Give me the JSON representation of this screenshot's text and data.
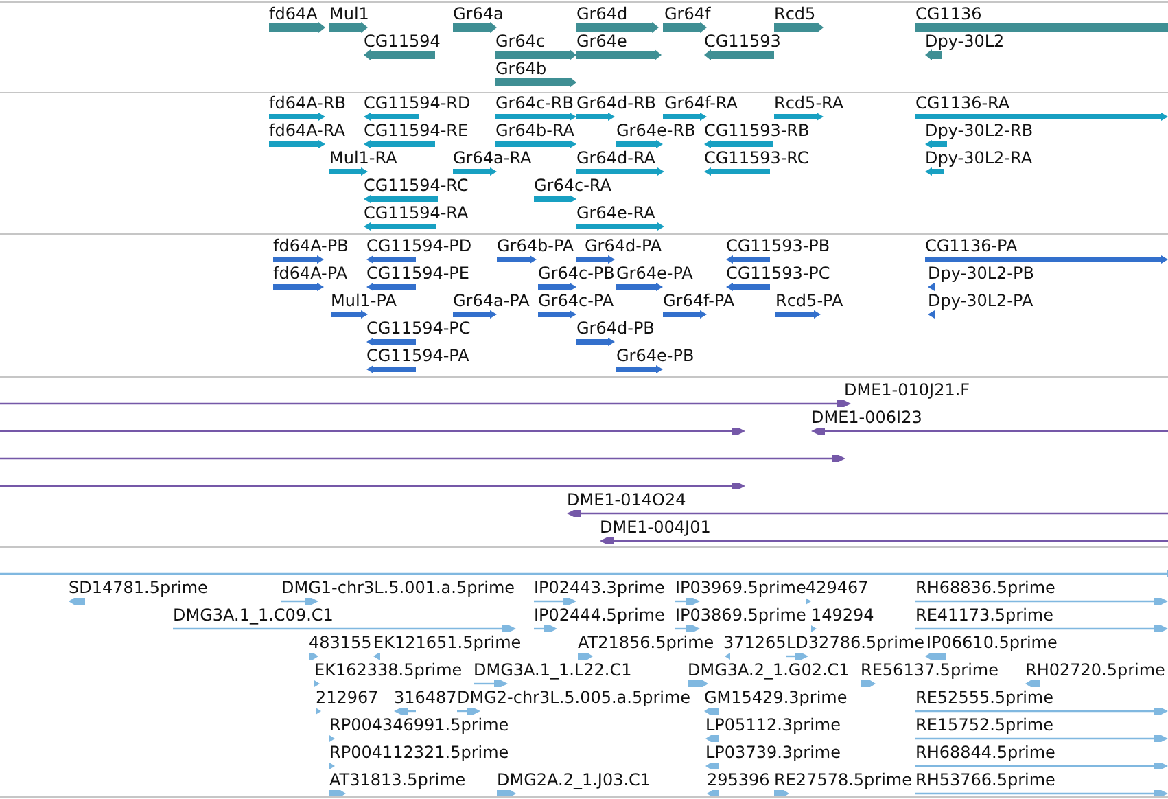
{
  "tracks": [
    {
      "kind": "gene",
      "features": [
        {
          "label": "fd64A",
          "reverse": false
        },
        {
          "label": "Mul1",
          "reverse": false
        },
        {
          "label": "Gr64a",
          "reverse": false
        },
        {
          "label": "Gr64d",
          "reverse": false
        },
        {
          "label": "Gr64f",
          "reverse": false
        },
        {
          "label": "Rcd5",
          "reverse": false
        },
        {
          "label": "CG1136",
          "reverse": false
        },
        {
          "label": "CG11594",
          "reverse": true
        },
        {
          "label": "Gr64c",
          "reverse": false
        },
        {
          "label": "Gr64e",
          "reverse": false
        },
        {
          "label": "CG11593",
          "reverse": true
        },
        {
          "label": "Dpy-30L2",
          "reverse": true
        },
        {
          "label": "Gr64b",
          "reverse": false
        }
      ]
    },
    {
      "kind": "transcript",
      "features": [
        {
          "label": "fd64A-RB",
          "reverse": false
        },
        {
          "label": "CG11594-RD",
          "reverse": true
        },
        {
          "label": "Gr64c-RB",
          "reverse": false
        },
        {
          "label": "Gr64d-RB",
          "reverse": false
        },
        {
          "label": "Gr64f-RA",
          "reverse": false
        },
        {
          "label": "Rcd5-RA",
          "reverse": false
        },
        {
          "label": "CG1136-RA",
          "reverse": false
        },
        {
          "label": "fd64A-RA",
          "reverse": false
        },
        {
          "label": "CG11594-RE",
          "reverse": true
        },
        {
          "label": "Gr64b-RA",
          "reverse": false
        },
        {
          "label": "Gr64e-RB",
          "reverse": false
        },
        {
          "label": "CG11593-RB",
          "reverse": true
        },
        {
          "label": "Dpy-30L2-RB",
          "reverse": true
        },
        {
          "label": "Mul1-RA",
          "reverse": false
        },
        {
          "label": "Gr64a-RA",
          "reverse": false
        },
        {
          "label": "Gr64d-RA",
          "reverse": false
        },
        {
          "label": "CG11593-RC",
          "reverse": true
        },
        {
          "label": "Dpy-30L2-RA",
          "reverse": true
        },
        {
          "label": "CG11594-RC",
          "reverse": true
        },
        {
          "label": "Gr64c-RA",
          "reverse": false
        },
        {
          "label": "CG11594-RA",
          "reverse": true
        },
        {
          "label": "Gr64e-RA",
          "reverse": false
        }
      ]
    },
    {
      "kind": "protein",
      "features": [
        {
          "label": "fd64A-PB",
          "reverse": false
        },
        {
          "label": "CG11594-PD",
          "reverse": true
        },
        {
          "label": "Gr64b-PA",
          "reverse": false
        },
        {
          "label": "Gr64d-PA",
          "reverse": false
        },
        {
          "label": "CG11593-PB",
          "reverse": true
        },
        {
          "label": "CG1136-PA",
          "reverse": false
        },
        {
          "label": "fd64A-PA",
          "reverse": false
        },
        {
          "label": "CG11594-PE",
          "reverse": true
        },
        {
          "label": "Gr64c-PB",
          "reverse": false
        },
        {
          "label": "Gr64e-PA",
          "reverse": false
        },
        {
          "label": "CG11593-PC",
          "reverse": true
        },
        {
          "label": "Dpy-30L2-PB",
          "reverse": true
        },
        {
          "label": "Mul1-PA",
          "reverse": false
        },
        {
          "label": "Gr64a-PA",
          "reverse": false
        },
        {
          "label": "Gr64c-PA",
          "reverse": false
        },
        {
          "label": "Gr64f-PA",
          "reverse": false
        },
        {
          "label": "Rcd5-PA",
          "reverse": false
        },
        {
          "label": "Dpy-30L2-PA",
          "reverse": true
        },
        {
          "label": "CG11594-PC",
          "reverse": true
        },
        {
          "label": "Gr64d-PB",
          "reverse": false
        },
        {
          "label": "CG11594-PA",
          "reverse": true
        },
        {
          "label": "Gr64e-PB",
          "reverse": false
        }
      ]
    },
    {
      "kind": "clone",
      "features": [
        {
          "label": "DME1-010J21.F",
          "reverse": false
        },
        {
          "reverse": false
        },
        {
          "label": "DME1-006I23",
          "reverse": true
        },
        {
          "reverse": false
        },
        {
          "reverse": false
        },
        {
          "label": "DME1-014O24",
          "reverse": true
        },
        {
          "label": "DME1-004J01",
          "reverse": true
        }
      ]
    },
    {
      "kind": "est",
      "features": [
        {
          "reverse": false
        },
        {
          "label": "SD14781.5prime",
          "reverse": true
        },
        {
          "label": "DMG1-chr3L.5.001.a.5prime",
          "reverse": false
        },
        {
          "label": "IP02443.3prime",
          "reverse": false
        },
        {
          "label": "IP03969.5prime",
          "reverse": false
        },
        {
          "label": "429467",
          "reverse": false
        },
        {
          "label": "RH68836.5prime",
          "reverse": false
        },
        {
          "label": "DMG3A.1_1.C09.C1",
          "reverse": false
        },
        {
          "label": "IP02444.5prime",
          "reverse": false
        },
        {
          "label": "IP03869.5prime",
          "reverse": false
        },
        {
          "label": "149294",
          "reverse": false
        },
        {
          "label": "RE41173.5prime",
          "reverse": false
        },
        {
          "label": "483155",
          "reverse": false
        },
        {
          "label": "EK121651.5prime",
          "reverse": true
        },
        {
          "label": "AT21856.5prime",
          "reverse": false
        },
        {
          "label": "371265",
          "reverse": true
        },
        {
          "label": "LD32786.5prime",
          "reverse": false
        },
        {
          "label": "IP06610.5prime",
          "reverse": true
        },
        {
          "label": "EK162338.5prime",
          "reverse": false
        },
        {
          "label": "DMG3A.1_1.L22.C1",
          "reverse": false
        },
        {
          "label": "DMG3A.2_1.G02.C1",
          "reverse": false
        },
        {
          "label": "RE56137.5prime",
          "reverse": false
        },
        {
          "label": "RH02720.5prime",
          "reverse": true
        },
        {
          "label": "212967",
          "reverse": false
        },
        {
          "label": "316487",
          "reverse": true
        },
        {
          "label": "DMG2-chr3L.5.005.a.5prime",
          "reverse": false
        },
        {
          "label": "GM15429.3prime",
          "reverse": true
        },
        {
          "label": "RE52555.5prime",
          "reverse": false
        },
        {
          "label": "RP004346991.5prime",
          "reverse": false
        },
        {
          "label": "LP05112.3prime",
          "reverse": true
        },
        {
          "label": "RE15752.5prime",
          "reverse": false
        },
        {
          "label": "RP004112321.5prime",
          "reverse": false
        },
        {
          "label": "LP03739.3prime",
          "reverse": true
        },
        {
          "label": "RH68844.5prime",
          "reverse": false
        },
        {
          "label": "AT31813.5prime",
          "reverse": false
        },
        {
          "label": "DMG2A.2_1.J03.C1",
          "reverse": false
        },
        {
          "label": "295396",
          "reverse": true
        },
        {
          "label": "RE27578.5prime",
          "reverse": false
        },
        {
          "label": "RH53766.5prime",
          "reverse": false
        }
      ]
    }
  ]
}
